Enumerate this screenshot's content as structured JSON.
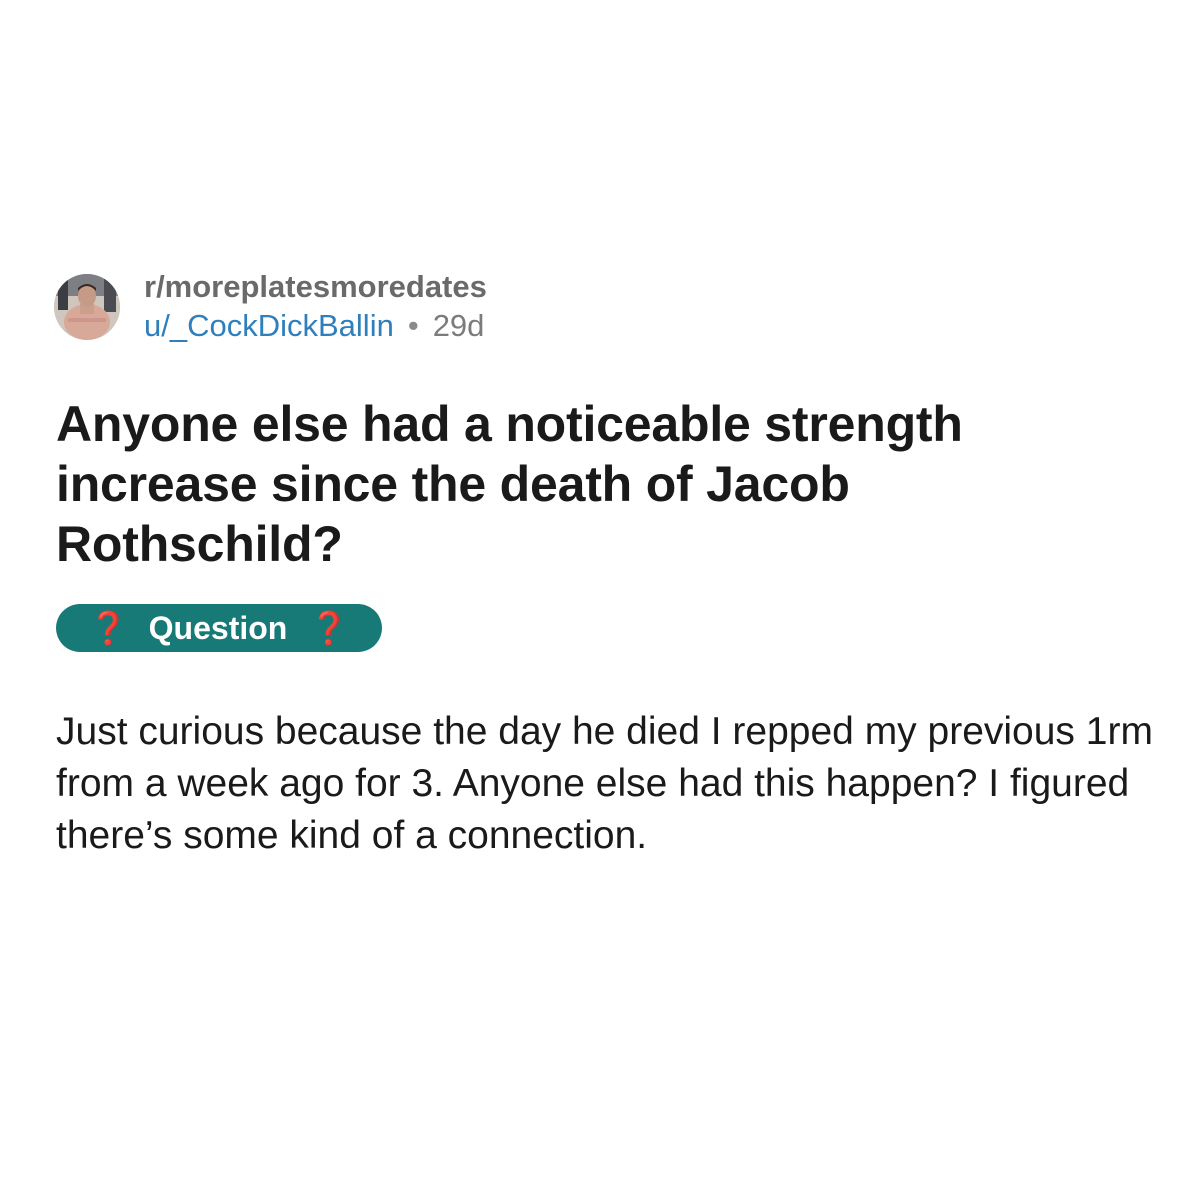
{
  "post": {
    "subreddit": "r/moreplatesmoredates",
    "username": "u/_CockDickBallin",
    "separator": "•",
    "age": "29d",
    "title": "Anyone else had a noticeable strength increase since the death of Jacob Rothschild?",
    "flair": {
      "label": "Question",
      "left_icon": "❓",
      "right_icon": "❓",
      "background": "#177a76",
      "icon_color": "#d6322a"
    },
    "body": "Just curious because the day he died I repped my previous 1rm from a week ago for 3. Anyone else had this happen? I figured there’s some kind of a connection."
  },
  "colors": {
    "username": "#2f7fbd",
    "meta_text": "#7c7c7c",
    "text": "#1a1a1b"
  },
  "icons": {
    "avatar": "user-avatar-photo",
    "flair_marker": "red-question-mark-icon"
  }
}
